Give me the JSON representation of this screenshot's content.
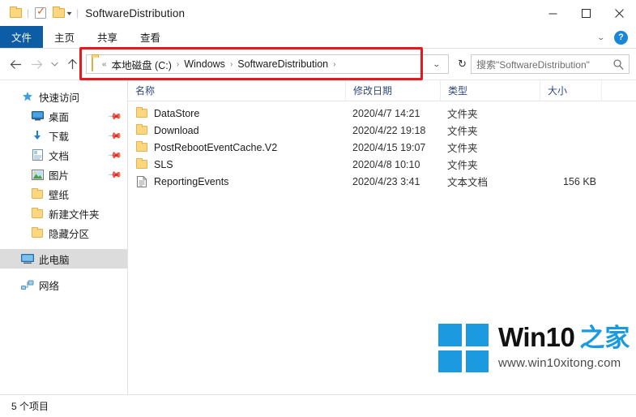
{
  "window": {
    "title": "SoftwareDistribution",
    "quick_access": [
      {
        "name": "save-icon",
        "glyph": "folder"
      },
      {
        "name": "properties-icon",
        "glyph": "properties"
      },
      {
        "name": "new-folder-icon",
        "glyph": "folder"
      }
    ],
    "controls": {
      "minimize": "minimize-button",
      "maximize": "maximize-button",
      "close": "close-button"
    }
  },
  "ribbon": {
    "file_tab": "文件",
    "tabs": [
      "主页",
      "共享",
      "查看"
    ],
    "expand_icon": "chevron-down-icon",
    "help_label": "?",
    "accent_color": "#0d5ca6"
  },
  "addressbar": {
    "back_icon": "←",
    "forward_icon": "→",
    "history_icon": "⌄",
    "up_icon": "↑",
    "overflow": "«",
    "crumbs": [
      "本地磁盘 (C:)",
      "Windows",
      "SoftwareDistribution"
    ],
    "dropdown_icon": "⌄",
    "refresh_icon": "↻"
  },
  "search": {
    "placeholder": "搜索\"SoftwareDistribution\"",
    "icon": "search-icon"
  },
  "sidebar": {
    "items": [
      {
        "label": "快速访问",
        "icon": "star-icon",
        "indent": 0,
        "pinned": false,
        "selected": false
      },
      {
        "label": "桌面",
        "icon": "desktop-icon",
        "indent": 1,
        "pinned": true,
        "selected": false
      },
      {
        "label": "下载",
        "icon": "download-icon",
        "indent": 1,
        "pinned": true,
        "selected": false
      },
      {
        "label": "文档",
        "icon": "documents-icon",
        "indent": 1,
        "pinned": true,
        "selected": false
      },
      {
        "label": "图片",
        "icon": "pictures-icon",
        "indent": 1,
        "pinned": true,
        "selected": false
      },
      {
        "label": "壁纸",
        "icon": "folder-icon",
        "indent": 1,
        "pinned": false,
        "selected": false
      },
      {
        "label": "新建文件夹",
        "icon": "folder-icon",
        "indent": 1,
        "pinned": false,
        "selected": false
      },
      {
        "label": "隐藏分区",
        "icon": "folder-icon",
        "indent": 1,
        "pinned": false,
        "selected": false
      },
      {
        "label": "此电脑",
        "icon": "computer-icon",
        "indent": 0,
        "pinned": false,
        "selected": true
      },
      {
        "label": "网络",
        "icon": "network-icon",
        "indent": 0,
        "pinned": false,
        "selected": false
      }
    ]
  },
  "filelist": {
    "columns": [
      "名称",
      "修改日期",
      "类型",
      "大小"
    ],
    "rows": [
      {
        "name": "DataStore",
        "date": "2020/4/7 14:21",
        "type": "文件夹",
        "size": "",
        "icon": "folder-icon"
      },
      {
        "name": "Download",
        "date": "2020/4/22 19:18",
        "type": "文件夹",
        "size": "",
        "icon": "folder-icon"
      },
      {
        "name": "PostRebootEventCache.V2",
        "date": "2020/4/15 19:07",
        "type": "文件夹",
        "size": "",
        "icon": "folder-icon"
      },
      {
        "name": "SLS",
        "date": "2020/4/8 10:10",
        "type": "文件夹",
        "size": "",
        "icon": "folder-icon"
      },
      {
        "name": "ReportingEvents",
        "date": "2020/4/23 3:41",
        "type": "文本文档",
        "size": "156 KB",
        "icon": "textfile-icon"
      }
    ]
  },
  "statusbar": {
    "item_count": "5 个项目"
  },
  "annotation": {
    "color": "#e8191e",
    "target": "address-bar"
  },
  "watermark": {
    "brand": "Win10",
    "brand_suffix": "之家",
    "url": "www.win10xitong.com",
    "logo_color": "#1b9ae0"
  }
}
